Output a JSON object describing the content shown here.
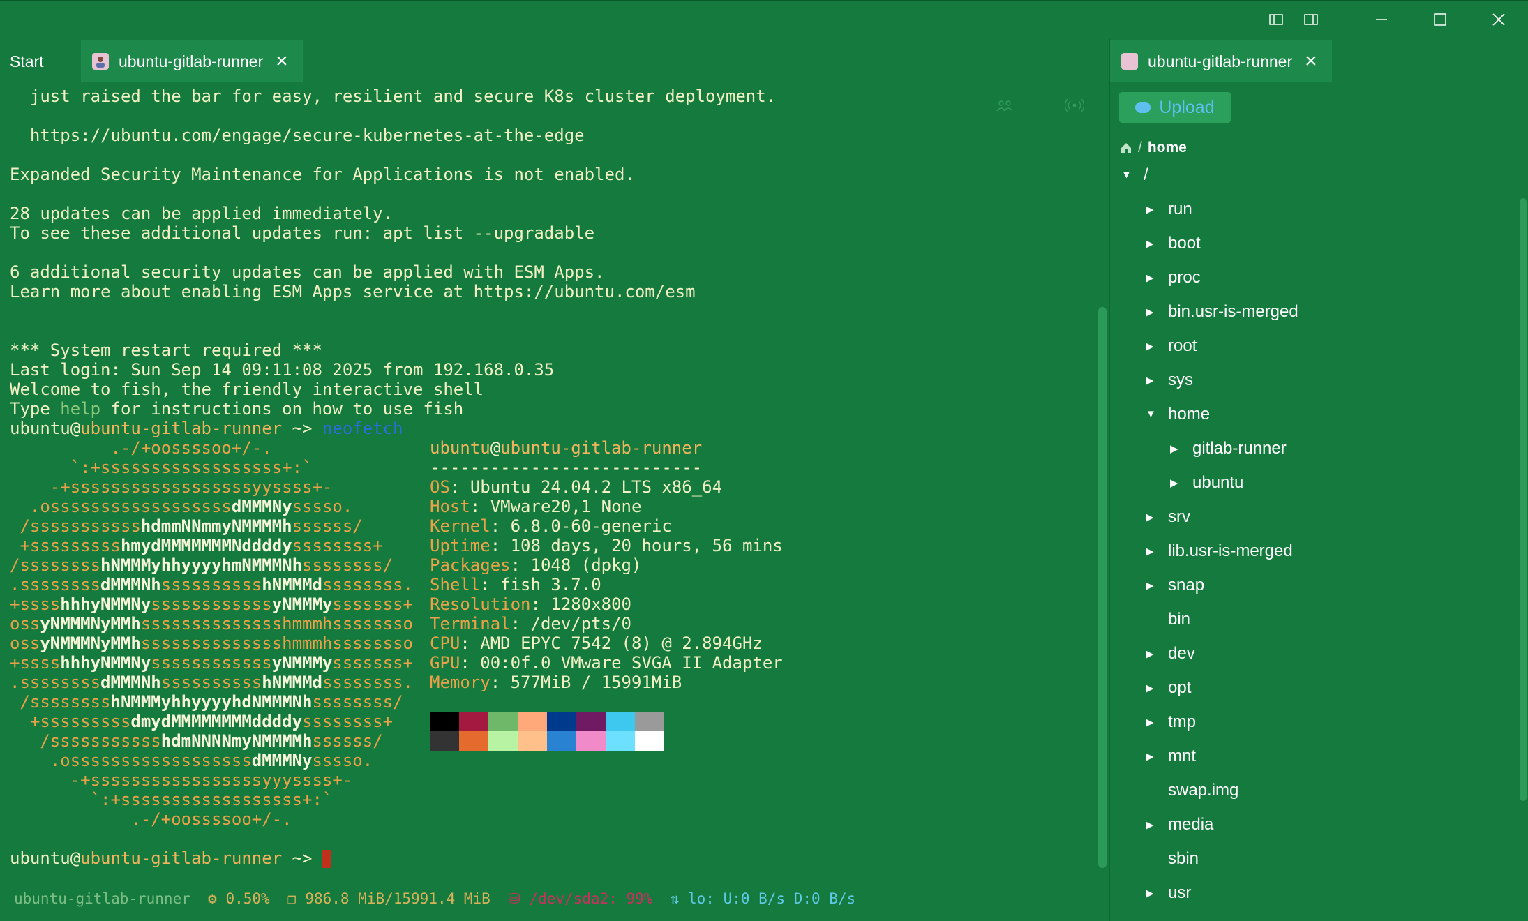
{
  "window": {
    "tabs": [
      {
        "label": "Start"
      },
      {
        "label": "ubuntu-gitlab-runner"
      }
    ],
    "side_tab": {
      "label": "ubuntu-gitlab-runner"
    }
  },
  "terminal": {
    "motd": [
      "  just raised the bar for easy, resilient and secure K8s cluster deployment.",
      "",
      "  https://ubuntu.com/engage/secure-kubernetes-at-the-edge",
      "",
      "Expanded Security Maintenance for Applications is not enabled.",
      "",
      "28 updates can be applied immediately.",
      "To see these additional updates run: apt list --upgradable",
      "",
      "6 additional security updates can be applied with ESM Apps.",
      "Learn more about enabling ESM Apps service at https://ubuntu.com/esm",
      "",
      "",
      "*** System restart required ***",
      "Last login: Sun Sep 14 09:11:08 2025 from 192.168.0.35",
      "Welcome to fish, the friendly interactive shell"
    ],
    "type_prefix": "Type ",
    "type_help": "help",
    "type_suffix": " for instructions on how to use fish",
    "prompt_user": "ubuntu",
    "prompt_at": "@",
    "prompt_host": "ubuntu-gitlab-runner",
    "prompt_tail": " ~> ",
    "command": "neofetch",
    "logo": [
      "          .-/+oossssoo+/-.",
      "      `:+ssssssssssssssssss+:`",
      "    -+ssssssssssssssssssyyssss+-",
      "  .ossssssssssssssssssdMMMNysssso.",
      " /ssssssssssshdmmNNmmyNMMMMhssssss/",
      " +ssssssssshmydMMMMMMMNddddyssssssss+",
      "/sssssssshNMMMyhhyyyyhmNMMMNhssssssss/",
      ".ssssssssdMMMNhsssssssssshNMMMdssssssss.",
      "+sssshhhyNMMNyssssssssssssyNMMMysssssss+",
      "ossyNMMMNyMMhsssssssssssssshmmmhssssssso",
      "ossyNMMMNyMMhsssssssssssssshmmmhssssssso",
      "+sssshhhyNMMNyssssssssssssyNMMMysssssss+",
      ".ssssssssdMMMNhsssssssssshNMMMdssssssss.",
      " /sssssssshNMMMyhhyyyyhdNMMMNhssssssss/",
      "  +sssssssssdmydMMMMMMMMddddyssssssss+",
      "   /ssssssssssshdmNNNNmyNMMMMhssssss/",
      "    .ossssssssssssssssssdMMMNysssso.",
      "      -+sssssssssssssssssyyyssss+-",
      "        `:+ssssssssssssssssss+:`",
      "            .-/+oossssoo+/-."
    ],
    "info_user": "ubuntu",
    "info_host": "ubuntu-gitlab-runner",
    "info_rule": "---------------------------",
    "info": [
      {
        "label": "OS",
        "value": "Ubuntu 24.04.2 LTS x86_64"
      },
      {
        "label": "Host",
        "value": "VMware20,1 None"
      },
      {
        "label": "Kernel",
        "value": "6.8.0-60-generic"
      },
      {
        "label": "Uptime",
        "value": "108 days, 20 hours, 56 mins"
      },
      {
        "label": "Packages",
        "value": "1048 (dpkg)"
      },
      {
        "label": "Shell",
        "value": "fish 3.7.0"
      },
      {
        "label": "Resolution",
        "value": "1280x800"
      },
      {
        "label": "Terminal",
        "value": "/dev/pts/0"
      },
      {
        "label": "CPU",
        "value": "AMD EPYC 7542 (8) @ 2.894GHz"
      },
      {
        "label": "GPU",
        "value": "00:0f.0 VMware SVGA II Adapter"
      },
      {
        "label": "Memory",
        "value": "577MiB / 15991MiB"
      }
    ],
    "palette_top": [
      "#000000",
      "#a3193f",
      "#6fb86a",
      "#ffa97a",
      "#003a8c",
      "#701a64",
      "#3ec8f0",
      "#9a9a9a"
    ],
    "palette_bottom": [
      "#333333",
      "#e56a2d",
      "#b8f3a3",
      "#ffc08a",
      "#2a82d2",
      "#f08ac8",
      "#6ee0ff",
      "#ffffff"
    ]
  },
  "status_bar": {
    "host": "ubuntu-gitlab-runner",
    "cpu": "0.50%",
    "mem": "986.8 MiB/15991.4 MiB",
    "disk": "/dev/sda2: 99%",
    "net": "lo: U:0 B/s D:0 B/s"
  },
  "sidebar": {
    "upload_label": "Upload",
    "breadcrumb_sep": "/",
    "breadcrumb_current": "home",
    "tree": [
      {
        "label": "/",
        "depth": 0,
        "caret": "down"
      },
      {
        "label": "run",
        "depth": 1,
        "caret": "right"
      },
      {
        "label": "boot",
        "depth": 1,
        "caret": "right"
      },
      {
        "label": "proc",
        "depth": 1,
        "caret": "right"
      },
      {
        "label": "bin.usr-is-merged",
        "depth": 1,
        "caret": "right"
      },
      {
        "label": "root",
        "depth": 1,
        "caret": "right"
      },
      {
        "label": "sys",
        "depth": 1,
        "caret": "right"
      },
      {
        "label": "home",
        "depth": 1,
        "caret": "down"
      },
      {
        "label": "gitlab-runner",
        "depth": 2,
        "caret": "right"
      },
      {
        "label": "ubuntu",
        "depth": 2,
        "caret": "right"
      },
      {
        "label": "srv",
        "depth": 1,
        "caret": "right"
      },
      {
        "label": "lib.usr-is-merged",
        "depth": 1,
        "caret": "right"
      },
      {
        "label": "snap",
        "depth": 1,
        "caret": "right"
      },
      {
        "label": "bin",
        "depth": 1,
        "caret": "none"
      },
      {
        "label": "dev",
        "depth": 1,
        "caret": "right"
      },
      {
        "label": "opt",
        "depth": 1,
        "caret": "right"
      },
      {
        "label": "tmp",
        "depth": 1,
        "caret": "right"
      },
      {
        "label": "mnt",
        "depth": 1,
        "caret": "right"
      },
      {
        "label": "swap.img",
        "depth": 1,
        "caret": "none"
      },
      {
        "label": "media",
        "depth": 1,
        "caret": "right"
      },
      {
        "label": "sbin",
        "depth": 1,
        "caret": "none"
      },
      {
        "label": "usr",
        "depth": 1,
        "caret": "right"
      }
    ]
  }
}
